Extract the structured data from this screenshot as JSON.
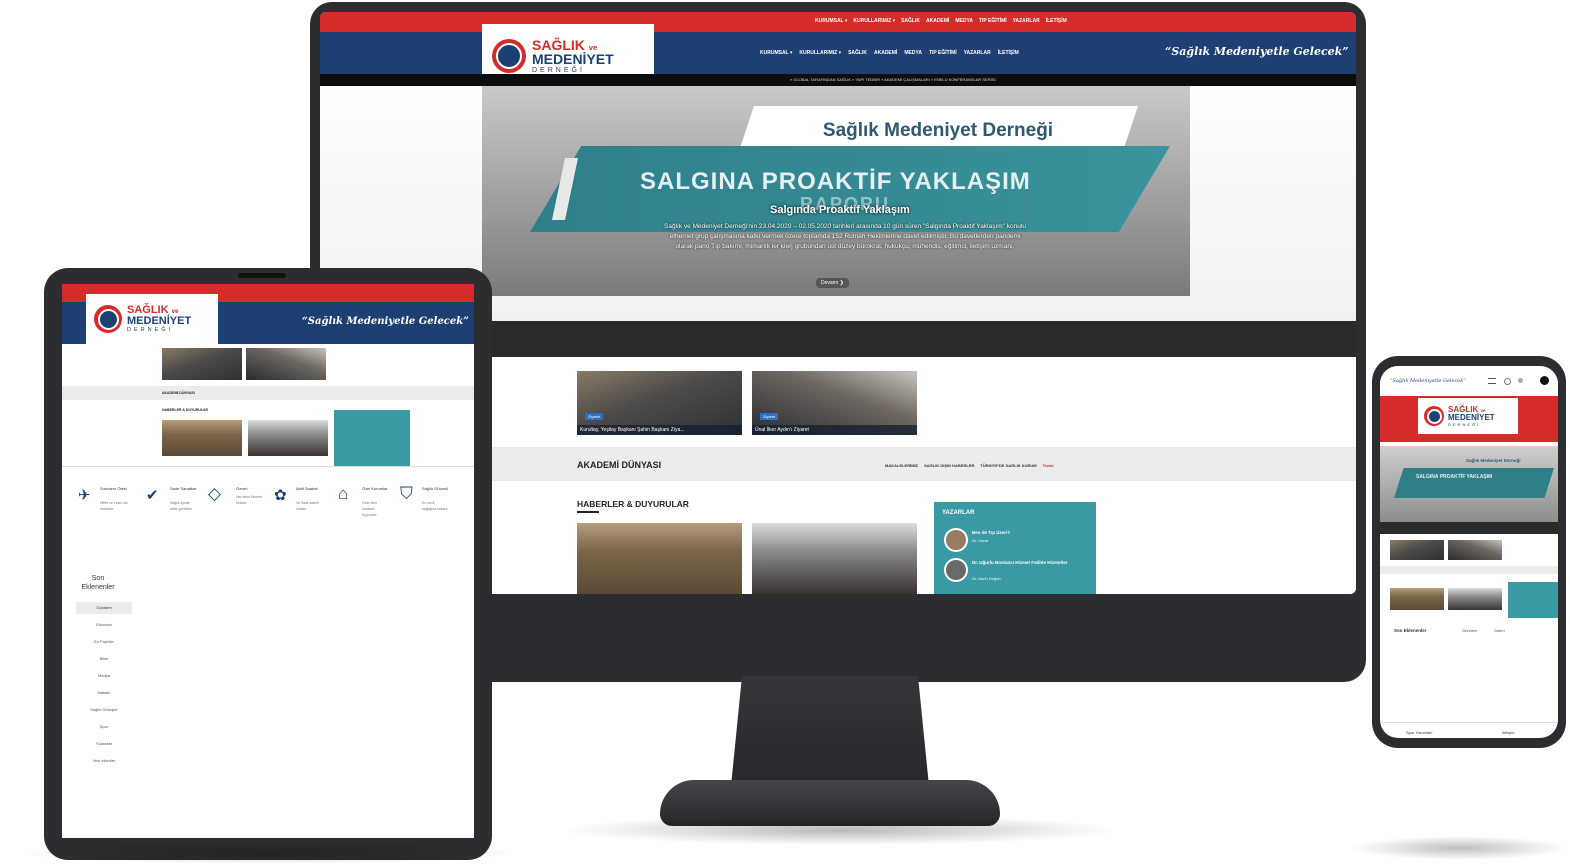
{
  "site": {
    "logo_line1": "SAĞLIK",
    "logo_line1_small": "ve",
    "logo_line2": "MEDENİYET",
    "logo_line3": "DERNEĞİ",
    "motto": "“Sağlık Medeniyetle Gelecek”"
  },
  "desktop": {
    "top_nav": [
      "KURUMSAL ▾",
      "KURULLARIMIZ ▾",
      "SAĞLIK",
      "AKADEMİ",
      "MEDYA",
      "TIP EĞİTİMİ",
      "YAZARLAR",
      "İLETİŞİM"
    ],
    "main_nav": [
      "KURUMSAL ▾",
      "KURULLARIMIZ ▾",
      "SAĞLIK",
      "AKADEMİ",
      "MEDYA",
      "TIP EĞİTİMİ",
      "YAZARLAR",
      "İLETİŞİM"
    ],
    "ticker": "» GLOBAL TARAFINDAN SAĞLIK   » YAPI TEDBİR   » AKADEMİ ÇALIŞMALARI   » ENELÜ KONFERANSLAR SERİSİ",
    "hero": {
      "banner_title": "Sağlık Medeniyet Derneği",
      "banner_sub": "SALGINA PROAKTİF YAKLAŞIM",
      "banner_sub2": "RAPORU",
      "slide_title": "Salgında Proaktif Yaklaşım",
      "slide_text": "Sağlık ve Medeniyet Derneği'nin 23.04.2020 – 02.05.2020 tarihleri arasında 10 gün süren \"Salgında Proaktif Yaklaşım\" konulu ethernet grup çalışmasına katkı vermek üzere toplamda 152 Rumah Hekimlerine davet edilmiştir. Bu davetlerden pandemi olarak pano Tıp bakımı, mimarlık ler klerj grubundan üst düzey bürokrat, hukukçu, mühendis, eğitimci, iletişim uzmanı,",
      "button": "Devamı ❯"
    },
    "cards": [
      {
        "badge": "Ziyaret",
        "caption": "Kurultay, Yeşilay Başkanı Şahin Başkanı Ziya..."
      },
      {
        "badge": "Ziyaret",
        "caption": "Ünal İlker Aydın'ı Ziyaret"
      }
    ],
    "academy": {
      "title": "AKADEMİ DÜNYASI",
      "links": [
        "MAKALELERİMİZ",
        "SAĞLIK DIŞIN HABERLER",
        "TÜRKİYE'DE SAĞLIK KURUM"
      ],
      "more": "Tümü"
    },
    "news": {
      "title": "HABERLER & DUYURULAR",
      "writers_title": "YAZARLAR",
      "writers": [
        {
          "title": "Ben de Tıp Üzeri?",
          "name": "Dr. Yazar"
        },
        {
          "title": "Dr. Uğurlu Bostancı Hizmet Fatihte Hizmetler",
          "name": "Dr. Nurlu Doğan"
        }
      ]
    }
  },
  "tablet": {
    "section_title": "AKADEMİ DÜNYASI",
    "news_title": "HABERLER & DUYURULAR",
    "features": [
      {
        "icon": "✈",
        "title": "Sınırların Ötesi",
        "text": "Hiffet ve Lesiz ulu maktadır"
      },
      {
        "icon": "✔",
        "title": "Sade Sanatkar",
        "text": "Sağlık içinde sade gerektirir"
      },
      {
        "icon": "◇",
        "title": "Özveri",
        "text": "Her birini Hizmet İmkanı"
      },
      {
        "icon": "✿",
        "title": "Aktif Saahat",
        "text": "Ve Saat sadeti imkanı"
      },
      {
        "icon": "⌂",
        "title": "Özel Kurumlar",
        "text": "Gide ölen İmkanın Kuyudaki"
      },
      {
        "icon": "⛉",
        "title": "Sağlık Güvenli",
        "text": "En sevil sağlığına imkanı"
      }
    ],
    "latest_title": "Son Eklenenler",
    "menu": [
      "Gündem",
      "Ekonomi",
      "En Popüler",
      "Bilim",
      "Medya",
      "Makale",
      "Sağlık Görüşler",
      "Spor",
      "Yüksekte",
      "Yeni eklenler"
    ]
  },
  "phone": {
    "motto": "“Sağlık Medeniyetle Gelecek”",
    "banner_title": "Sağlık Medeniyet Derneği",
    "banner_sub": "SALGINA PROAKTİF YAKLAŞIM",
    "latest_title": "Son Eklenenler",
    "tab1": "Gündem",
    "tab2": "Galeri",
    "footer_left": "Spor Yorumları",
    "footer_right": "İletişim"
  },
  "colors": {
    "red": "#d52b2b",
    "navy": "#1d3f72",
    "teal": "#3a9aa3",
    "bezel": "#2b2d31"
  }
}
